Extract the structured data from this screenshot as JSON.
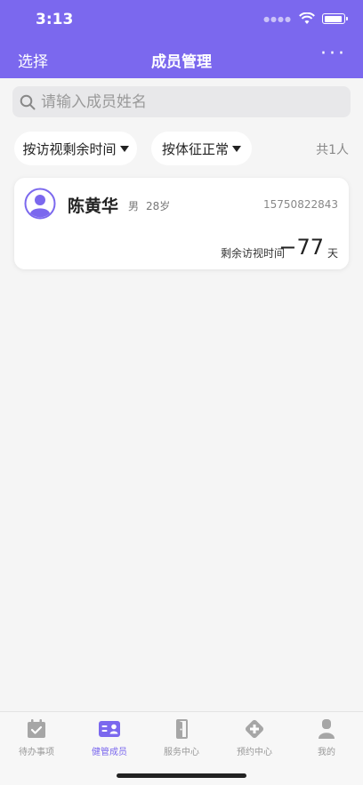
{
  "status_bar": {
    "time": "3:13"
  },
  "nav": {
    "left_label": "选择",
    "title": "成员管理",
    "more": "···"
  },
  "search": {
    "placeholder": "请输入成员姓名",
    "value": ""
  },
  "filters": [
    {
      "label": "按访视剩余时间"
    },
    {
      "label": "按体征正常"
    }
  ],
  "count_text": "共1人",
  "members": [
    {
      "name": "陈黄华",
      "gender": "男",
      "age": "28岁",
      "phone": "15750822843",
      "visit_label": "剩余访视时间",
      "visit_value": "−77",
      "visit_unit": "天"
    }
  ],
  "tabs": [
    {
      "label": "待办事项",
      "icon": "calendar-check-icon",
      "active": false
    },
    {
      "label": "健管成员",
      "icon": "member-card-icon",
      "active": true
    },
    {
      "label": "服务中心",
      "icon": "door-icon",
      "active": false
    },
    {
      "label": "预约中心",
      "icon": "medical-plus-icon",
      "active": false
    },
    {
      "label": "我的",
      "icon": "user-icon",
      "active": false
    }
  ],
  "colors": {
    "primary": "#7b68ee",
    "inactive": "#999999",
    "background": "#f5f5f5"
  }
}
